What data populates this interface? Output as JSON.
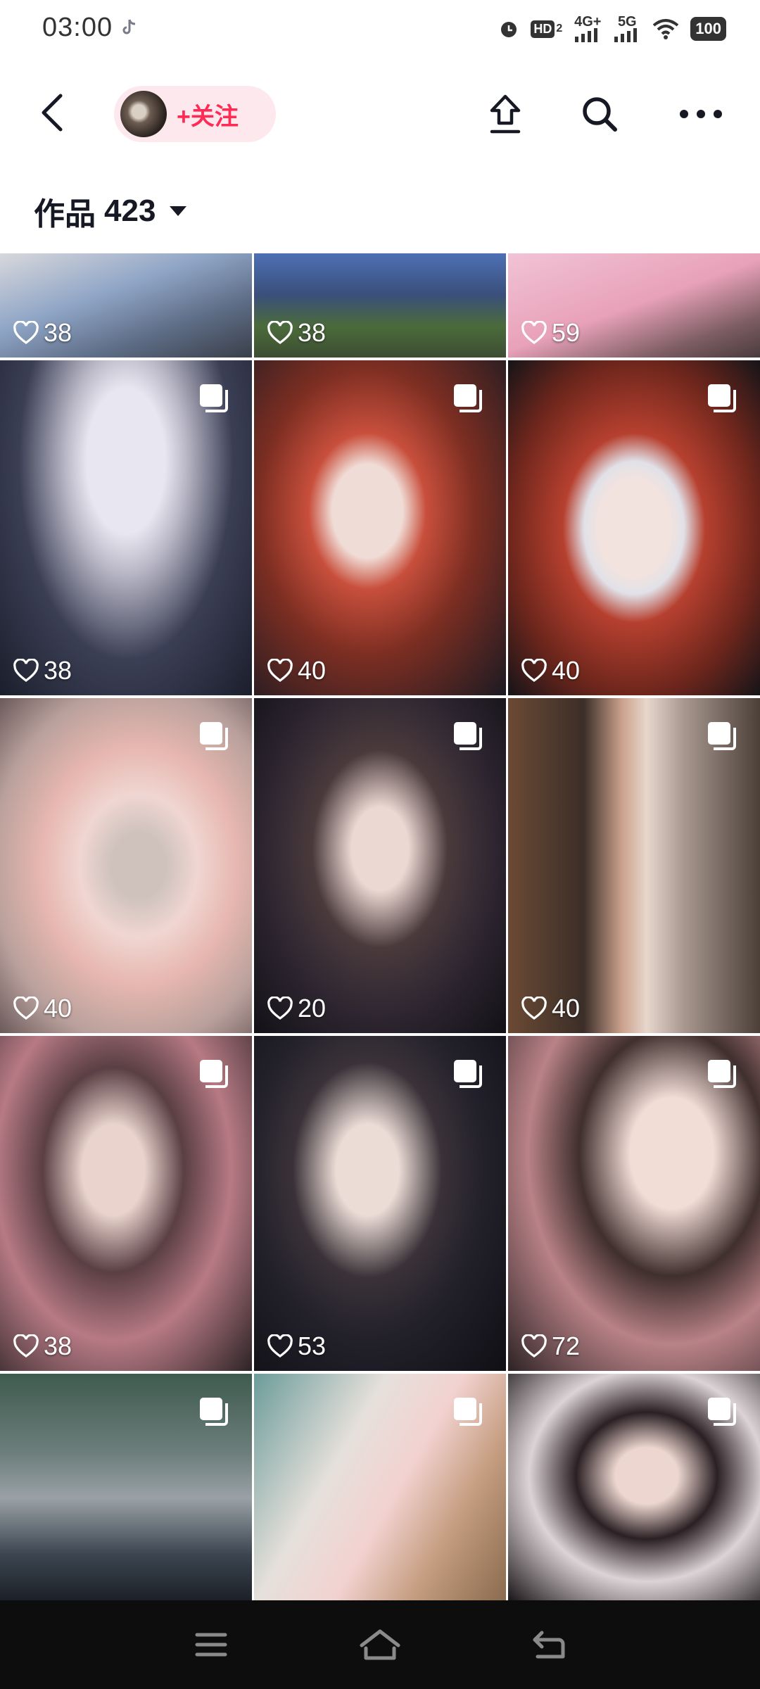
{
  "status_bar": {
    "time": "03:00",
    "hd_label": "HD",
    "hd_sub": "2",
    "net1": "4G+",
    "net2": "5G",
    "battery": "100"
  },
  "header": {
    "follow_label": "+关注",
    "icons": [
      "back-icon",
      "share-icon",
      "search-icon",
      "more-icon"
    ]
  },
  "section": {
    "label": "作品",
    "count": "423"
  },
  "tiles": [
    {
      "likes": "38",
      "multi": false
    },
    {
      "likes": "38",
      "multi": false
    },
    {
      "likes": "59",
      "multi": false
    },
    {
      "likes": "38",
      "multi": true
    },
    {
      "likes": "40",
      "multi": true
    },
    {
      "likes": "40",
      "multi": true
    },
    {
      "likes": "40",
      "multi": true
    },
    {
      "likes": "20",
      "multi": true
    },
    {
      "likes": "40",
      "multi": true
    },
    {
      "likes": "38",
      "multi": true
    },
    {
      "likes": "53",
      "multi": true
    },
    {
      "likes": "72",
      "multi": true
    },
    {
      "likes": "",
      "multi": true
    },
    {
      "likes": "",
      "multi": true
    },
    {
      "likes": "",
      "multi": true
    }
  ],
  "colors": {
    "accent": "#fe2c55",
    "pill_bg": "#fde8ee",
    "nav_bg": "#0d0d0d"
  }
}
